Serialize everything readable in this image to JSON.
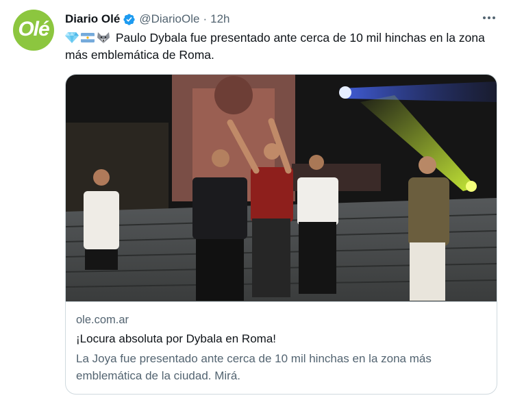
{
  "tweet": {
    "avatar_text": "Olé",
    "display_name": "Diario Olé",
    "handle": "@DiarioOle",
    "separator": "·",
    "time": "12h",
    "emojis": [
      "gem-icon",
      "argentina-flag-icon",
      "wolf-icon"
    ],
    "text": "Paulo Dybala fue presentado ante cerca de 10 mil hinchas en la zona más emblemática de Roma."
  },
  "card": {
    "image_icon": "photo-dybala-presentation",
    "domain": "ole.com.ar",
    "title": "¡Locura absoluta por Dybala en Roma!",
    "description": "La Joya fue presentado ante cerca de 10 mil hinchas en la zona más emblemática de la ciudad. Mirá."
  },
  "colors": {
    "avatar_bg": "#8cc63f",
    "verified": "#1d9bf0",
    "secondary_text": "#536471",
    "primary_text": "#0f1419",
    "border": "#cfd9de"
  }
}
